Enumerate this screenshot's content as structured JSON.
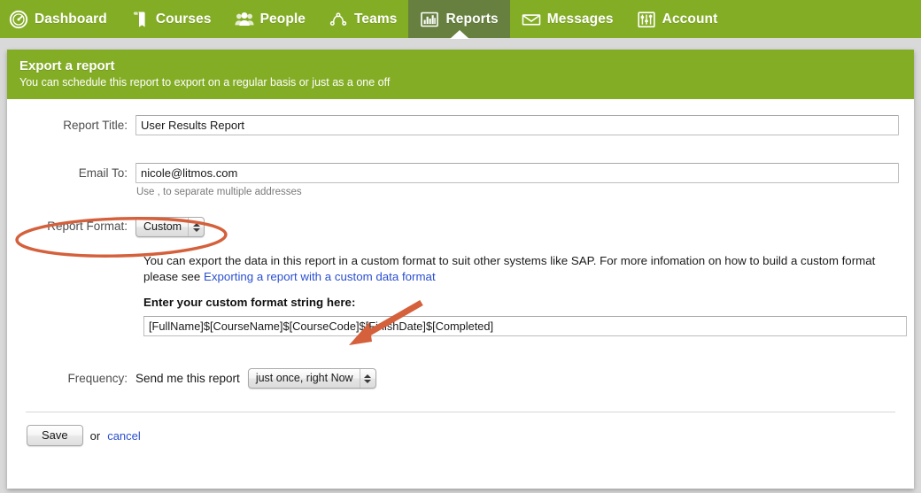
{
  "nav": {
    "items": [
      {
        "label": "Dashboard",
        "icon": "speedometer-icon",
        "active": false
      },
      {
        "label": "Courses",
        "icon": "book-icon",
        "active": false
      },
      {
        "label": "People",
        "icon": "people-icon",
        "active": false
      },
      {
        "label": "Teams",
        "icon": "network-icon",
        "active": false
      },
      {
        "label": "Reports",
        "icon": "bar-chart-icon",
        "active": true
      },
      {
        "label": "Messages",
        "icon": "envelope-icon",
        "active": false
      },
      {
        "label": "Account",
        "icon": "sliders-icon",
        "active": false
      }
    ],
    "bg_color": "#84ad26",
    "active_color": "#67803f"
  },
  "panel": {
    "title": "Export a report",
    "subtitle": "You can schedule this report to export on a regular basis or just as a one off"
  },
  "form": {
    "report_title": {
      "label": "Report Title:",
      "value": "User Results Report",
      "placeholder": ""
    },
    "email_to": {
      "label": "Email To:",
      "value": "nicole@litmos.com",
      "placeholder": "",
      "hint": "Use , to separate multiple addresses"
    },
    "report_format": {
      "label": "Report Format:",
      "selected": "Custom",
      "options": [
        "Custom"
      ]
    },
    "description": {
      "text_before_link": "You can export the data in this report in a custom format to suit other systems like SAP. For more infomation on how to build a custom format please see ",
      "link_text": "Exporting a report with a custom data format",
      "link_color": "#2b4fd0"
    },
    "custom_format": {
      "heading": "Enter your custom format string here:",
      "value": "[FullName]$[CourseName]$[CourseCode]$[FinishDate]$[Completed]",
      "placeholder": ""
    },
    "frequency": {
      "label": "Frequency:",
      "sentence": "Send me this report",
      "selected": "just once, right Now",
      "options": [
        "just once, right Now"
      ]
    }
  },
  "actions": {
    "save_label": "Save",
    "or_label": "or",
    "cancel_label": "cancel"
  },
  "annotations": {
    "color": "#d4603c",
    "ellipse": {
      "target": "report-format-row"
    },
    "arrow": {
      "target": "custom-format-input"
    }
  }
}
